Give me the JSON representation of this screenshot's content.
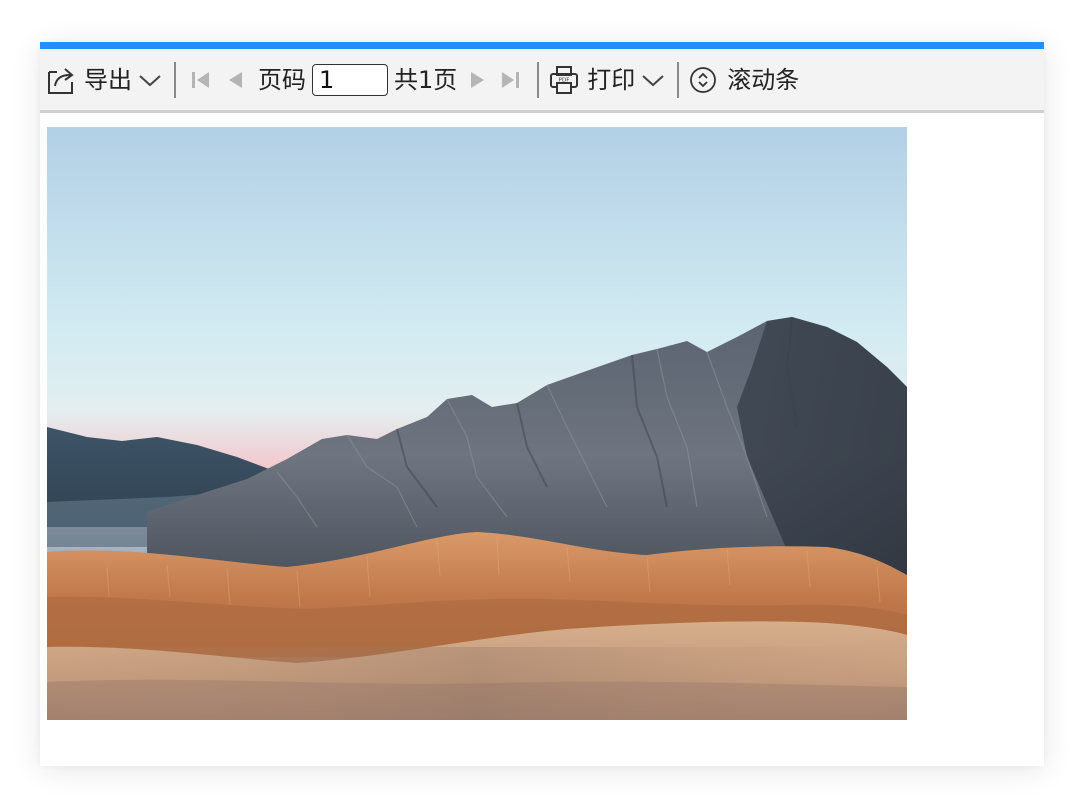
{
  "colors": {
    "accent": "#1e90ff",
    "toolbar_bg": "#f3f3f3",
    "disabled_nav": "#b5b5b5"
  },
  "toolbar": {
    "export_label": "导出",
    "page_label": "页码",
    "page_value": "1",
    "total_pages_label": "共1页",
    "print_label": "打印",
    "scrollbar_label": "滚动条"
  },
  "icons": {
    "export": "export-icon",
    "export_dropdown": "chevron-down-icon",
    "first_page": "first-page-icon",
    "prev_page": "prev-page-icon",
    "next_page": "next-page-icon",
    "last_page": "last-page-icon",
    "print": "pdf-printer-icon",
    "print_dropdown": "chevron-down-icon",
    "scrollbar": "scroll-toggle-icon"
  },
  "report": {
    "image_subject": "landscape-mountain-desert"
  }
}
